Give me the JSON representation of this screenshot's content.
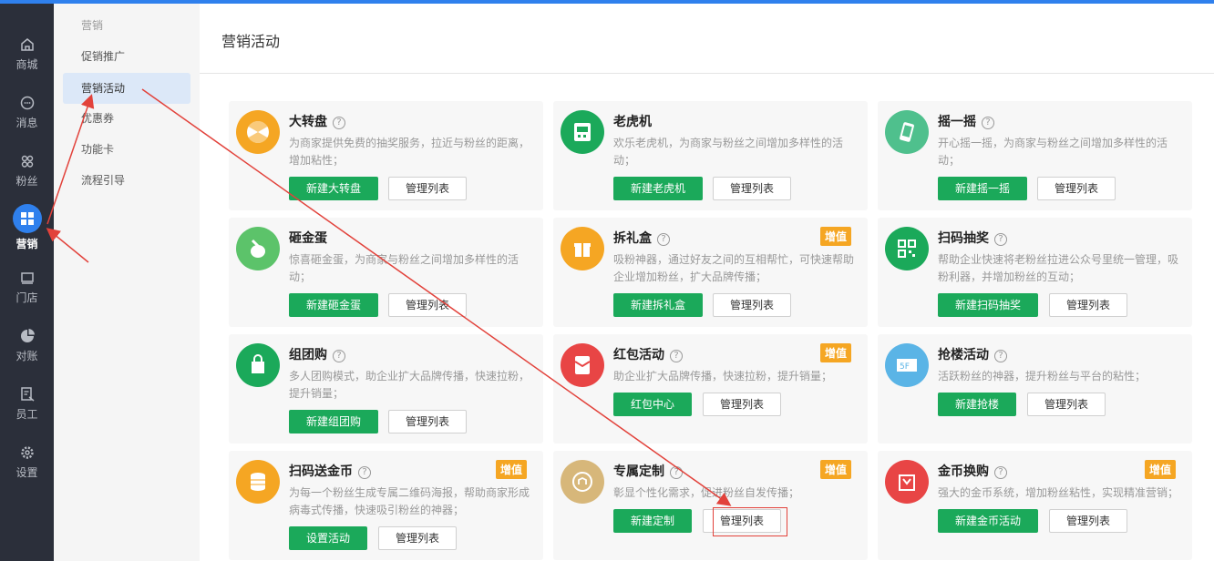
{
  "rail": [
    {
      "label": "商城",
      "icon": "home-icon"
    },
    {
      "label": "消息",
      "icon": "chat-icon"
    },
    {
      "label": "粉丝",
      "icon": "fans-icon"
    },
    {
      "label": "营销",
      "icon": "grid-icon"
    },
    {
      "label": "门店",
      "icon": "store-icon"
    },
    {
      "label": "对账",
      "icon": "pie-icon"
    },
    {
      "label": "员工",
      "icon": "staff-icon"
    },
    {
      "label": "设置",
      "icon": "gear-icon"
    }
  ],
  "subnav": {
    "heading": "营销",
    "items": [
      "促销推广",
      "营销活动",
      "优惠券",
      "功能卡",
      "流程引导"
    ]
  },
  "main": {
    "title": "营销活动"
  },
  "cards": [
    {
      "name": "大转盘",
      "desc": "为商家提供免费的抽奖服务，拉近与粉丝的距离，增加粘性；",
      "primary": "新建大转盘",
      "secondary": "管理列表",
      "badge": "",
      "color": "#f5a623",
      "icon": "wheel-icon"
    },
    {
      "name": "老虎机",
      "desc": "欢乐老虎机，为商家与粉丝之间增加多样性的活动；",
      "primary": "新建老虎机",
      "secondary": "管理列表",
      "badge": "",
      "color": "#1ba95a",
      "icon": "slot-machine-icon"
    },
    {
      "name": "摇一摇",
      "desc": "开心摇一摇，为商家与粉丝之间增加多样性的活动；",
      "primary": "新建摇一摇",
      "secondary": "管理列表",
      "badge": "",
      "color": "#4fc08d",
      "icon": "phone-shake-icon"
    },
    {
      "name": "砸金蛋",
      "desc": "惊喜砸金蛋，为商家与粉丝之间增加多样性的活动；",
      "primary": "新建砸金蛋",
      "secondary": "管理列表",
      "badge": "",
      "color": "#5cc36a",
      "icon": "golden-egg-icon"
    },
    {
      "name": "拆礼盒",
      "desc": "吸粉神器，通过好友之间的互相帮忙，可快速帮助企业增加粉丝，扩大品牌传播；",
      "primary": "新建拆礼盒",
      "secondary": "管理列表",
      "badge": "增值",
      "color": "#f5a623",
      "icon": "gift-box-icon"
    },
    {
      "name": "扫码抽奖",
      "desc": "帮助企业快速将老粉丝拉进公众号里统一管理，吸粉利器，并增加粉丝的互动；",
      "primary": "新建扫码抽奖",
      "secondary": "管理列表",
      "badge": "",
      "color": "#1ba95a",
      "icon": "qr-code-icon"
    },
    {
      "name": "组团购",
      "desc": "多人团购模式，助企业扩大品牌传播，快速拉粉，提升销量；",
      "primary": "新建组团购",
      "secondary": "管理列表",
      "badge": "",
      "color": "#1ba95a",
      "icon": "shopping-bag-icon"
    },
    {
      "name": "红包活动",
      "desc": "助企业扩大品牌传播，快速拉粉，提升销量；",
      "primary": "红包中心",
      "secondary": "管理列表",
      "badge": "增值",
      "color": "#e84545",
      "icon": "red-envelope-icon"
    },
    {
      "name": "抢楼活动",
      "desc": "活跃粉丝的神器，提升粉丝与平台的粘性；",
      "primary": "新建抢楼",
      "secondary": "管理列表",
      "badge": "",
      "color": "#5ab4e6",
      "icon": "floor-icon"
    },
    {
      "name": "扫码送金币",
      "desc": "为每一个粉丝生成专属二维码海报，帮助商家形成病毒式传播，快速吸引粉丝的神器；",
      "primary": "设置活动",
      "secondary": "管理列表",
      "badge": "增值",
      "color": "#f5a623",
      "icon": "coins-icon"
    },
    {
      "name": "专属定制",
      "desc": "彰显个性化需求，促进粉丝自发传播；",
      "primary": "新建定制",
      "secondary": "管理列表",
      "badge": "增值",
      "color": "#d7b77a",
      "icon": "badge-icon"
    },
    {
      "name": "金币换购",
      "desc": "强大的金币系统，增加粉丝粘性，实现精准营销；",
      "primary": "新建金币活动",
      "secondary": "管理列表",
      "badge": "增值",
      "color": "#e84545",
      "icon": "exchange-bag-icon"
    }
  ],
  "help_glyph": "?",
  "colors": {
    "accent": "#2f80ed",
    "green": "#1ba95a",
    "annotation": "#e2423b",
    "badge": "#f5a623"
  }
}
